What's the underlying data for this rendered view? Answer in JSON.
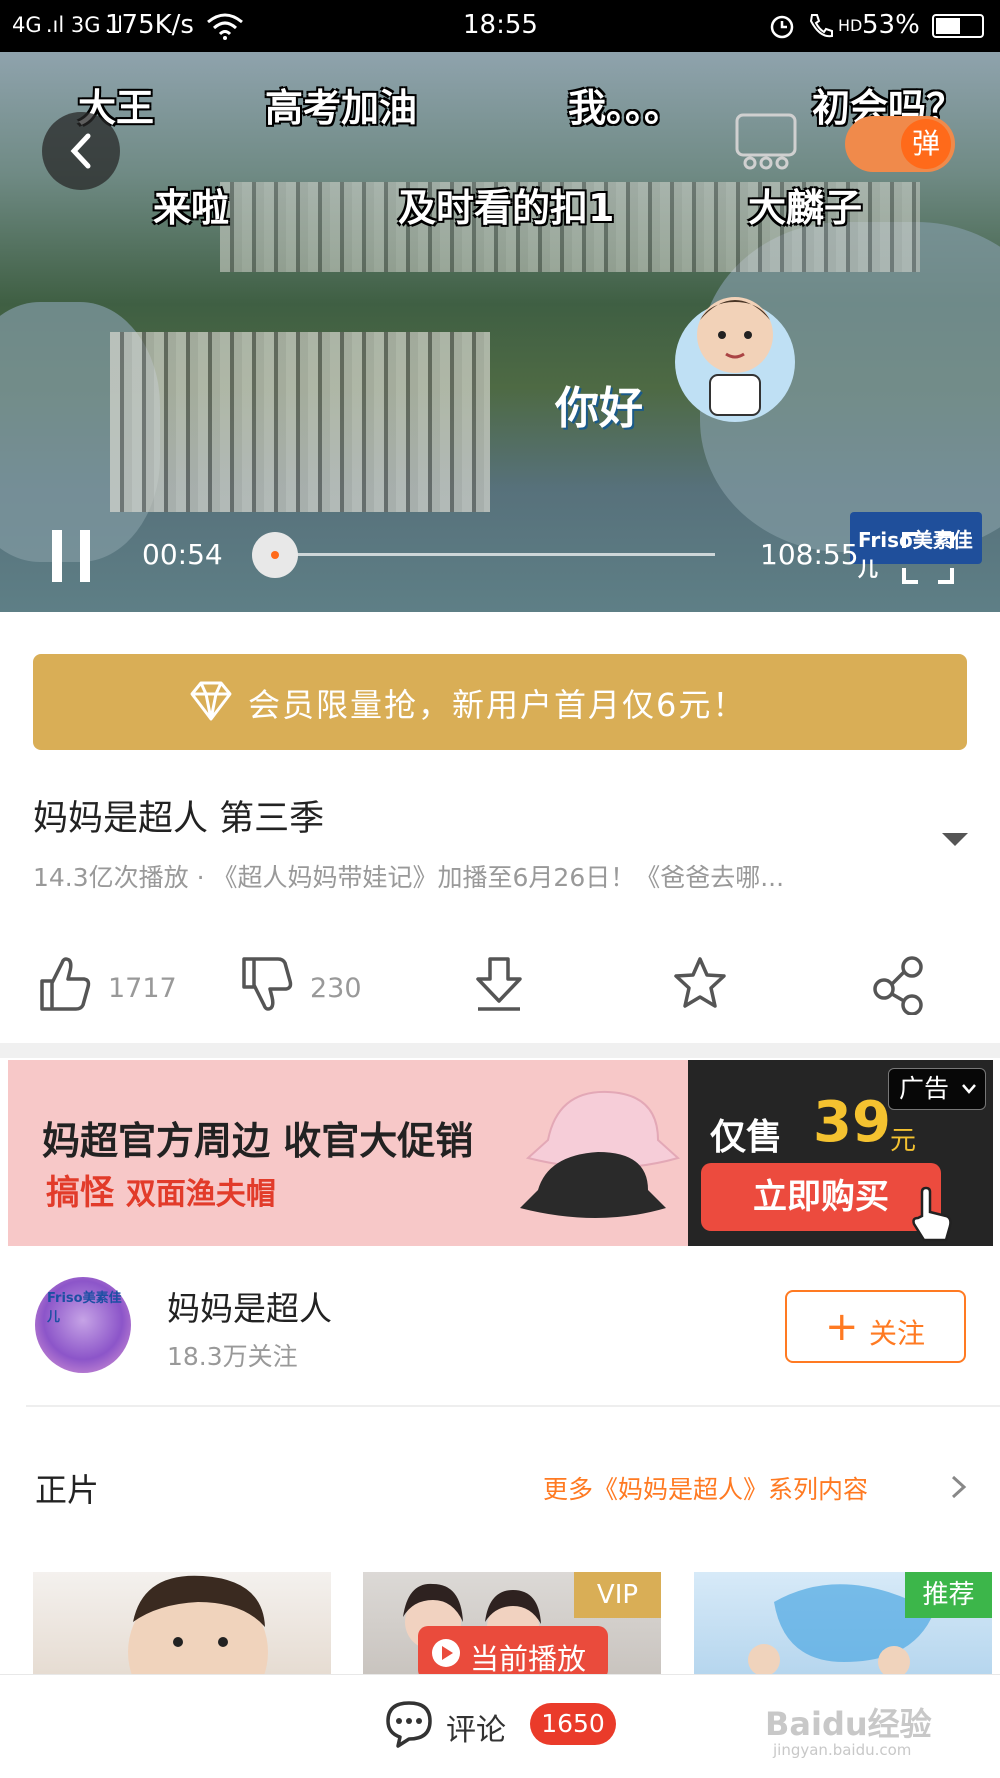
{
  "status_bar": {
    "signal": "4G .ıl 3G .ıl",
    "speed": "175K/s",
    "time": "18:55",
    "hd": "HD",
    "battery": "53%"
  },
  "video": {
    "danmaku": [
      "大王",
      "高考加油",
      "我。。。",
      "初会吗？",
      "来啦",
      "及时看的扣1",
      "大麟子"
    ],
    "toggle_label": "弹",
    "sticker_text": "你好",
    "sponsor_logo": "Friso美素佳儿",
    "current_time": "00:54",
    "duration": "108:55",
    "progress_fraction": 0.0083
  },
  "vip_banner": {
    "text": "会员限量抢，新用户首月仅6元！"
  },
  "show": {
    "title": "妈妈是超人 第三季",
    "subtitle": "14.3亿次播放 · 《超人妈妈带娃记》加播至6月26日！《爸爸去哪..."
  },
  "actions": {
    "like_count": "1717",
    "dislike_count": "230"
  },
  "ad": {
    "line1": "妈超官方周边 收官大促销",
    "line2_a": "搞怪",
    "line2_b": "双面渔夫帽",
    "price_label": "仅售",
    "price": "39",
    "unit": "元",
    "buy_label": "立即购买",
    "ad_tag": "广告"
  },
  "channel": {
    "name": "妈妈是超人",
    "followers": "18.3万关注",
    "follow_label": "关注",
    "avatar_logo": "Friso美素佳儿"
  },
  "episodes": {
    "section_title": "正片",
    "more_label": "更多《妈妈是超人》系列内容",
    "badge_vip": "VIP",
    "badge_rec": "推荐",
    "now_playing": "当前播放"
  },
  "bottom_bar": {
    "comment_label": "评论",
    "comment_count": "1650",
    "watermark": "Baidu经验",
    "watermark_url": "jingyan.baidu.com"
  },
  "colors": {
    "accent": "#ff7a22",
    "vip_gold": "#d9ae56",
    "red": "#ea3b2a",
    "green_badge": "#3cb64a"
  }
}
